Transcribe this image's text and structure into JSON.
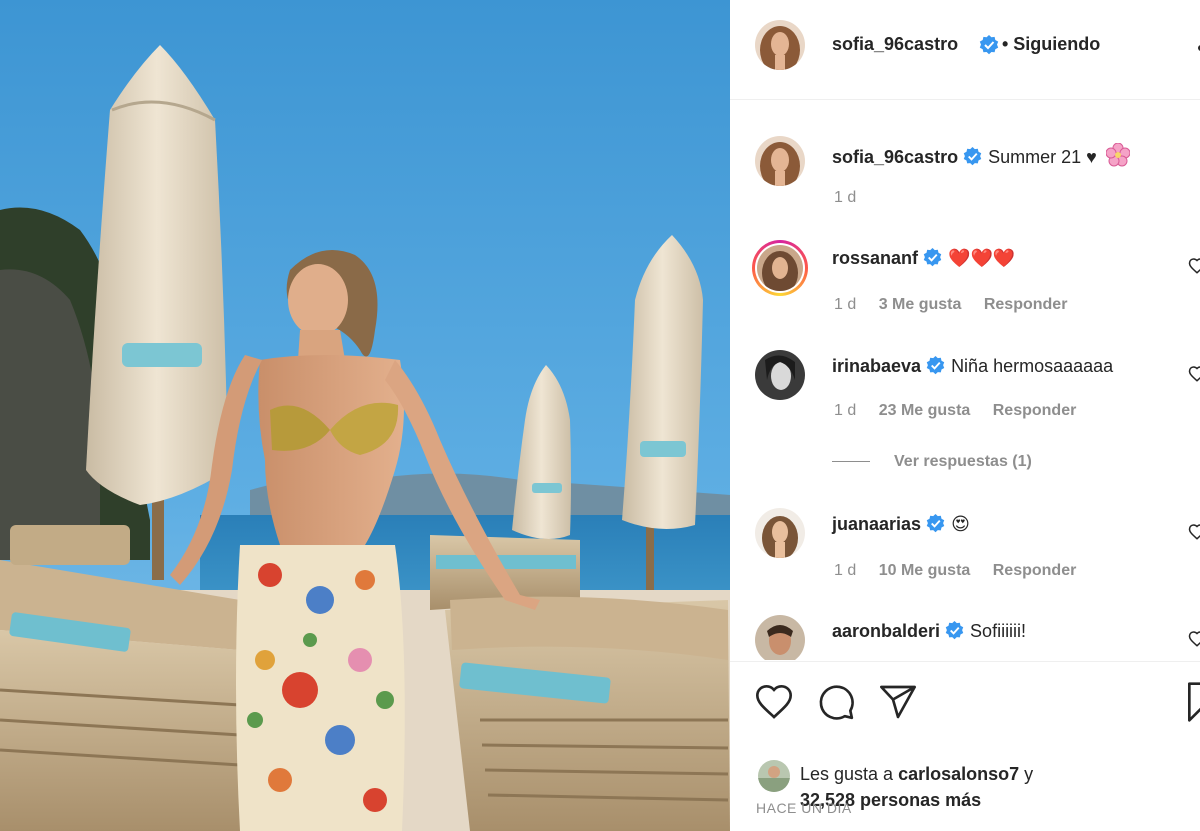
{
  "post": {
    "author": "sofia_96castro",
    "follow_status": "• Siguiendo"
  },
  "caption": {
    "username": "sofia_96castro",
    "text": "Summer 21 ♥",
    "time": "1 d"
  },
  "comments": [
    {
      "username": "rossananf",
      "text": "❤️❤️❤️",
      "time": "1 d",
      "likes": "3 Me gusta",
      "reply": "Responder"
    },
    {
      "username": "irinabaeva",
      "text": "Niña hermosaaaaaa",
      "time": "1 d",
      "likes": "23 Me gusta",
      "reply": "Responder"
    },
    {
      "username": "juanaarias",
      "text": "😍",
      "time": "1 d",
      "likes": "10 Me gusta",
      "reply": "Responder"
    },
    {
      "username": "aaronbalderi",
      "text": "Sofiiiiii!"
    }
  ],
  "view_replies": "Ver respuestas (1)",
  "likes": {
    "prefix": "Les gusta a",
    "user": "carlosalonso7",
    "suffix": "y",
    "count": "32,528 personas más"
  },
  "posted": "HACE UN DÍA",
  "icons": [
    "heart-icon",
    "comment-icon",
    "share-icon",
    "bookmark-icon",
    "verified-icon",
    "more-icon"
  ],
  "colors": {
    "verified": "#3897f0",
    "text": "#262626",
    "muted": "#8e8e8e",
    "heart": "#ed4956"
  }
}
